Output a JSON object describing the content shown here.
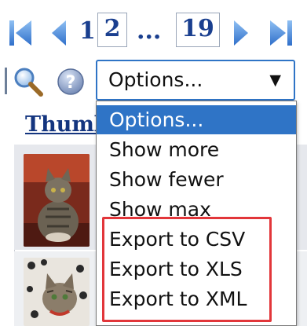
{
  "pager": {
    "first_icon": "first-page-icon",
    "prev_icon": "previous-page-icon",
    "next_icon": "next-page-icon",
    "last_icon": "last-page-icon",
    "page_first": "1",
    "page_current": "2",
    "ellipsis": "...",
    "page_last": "19"
  },
  "toolbar": {
    "search_icon": "magnifier-icon",
    "help_icon": "help-icon"
  },
  "select": {
    "value": "Options...",
    "arrow": "▼"
  },
  "dropdown": {
    "options": [
      "Options...",
      "Show more",
      "Show fewer",
      "Show max",
      "Export to CSV",
      "Export to XLS",
      "Export to XML"
    ],
    "selected_index": 0,
    "highlighted_group": [
      "Export to CSV",
      "Export to XLS",
      "Export to XML"
    ]
  },
  "grid": {
    "column_header": "Thumb"
  },
  "colors": {
    "accent": "#2f74c6",
    "link": "#14357f",
    "highlight_border": "#e2363a",
    "row_band": "#e6e8ed"
  }
}
